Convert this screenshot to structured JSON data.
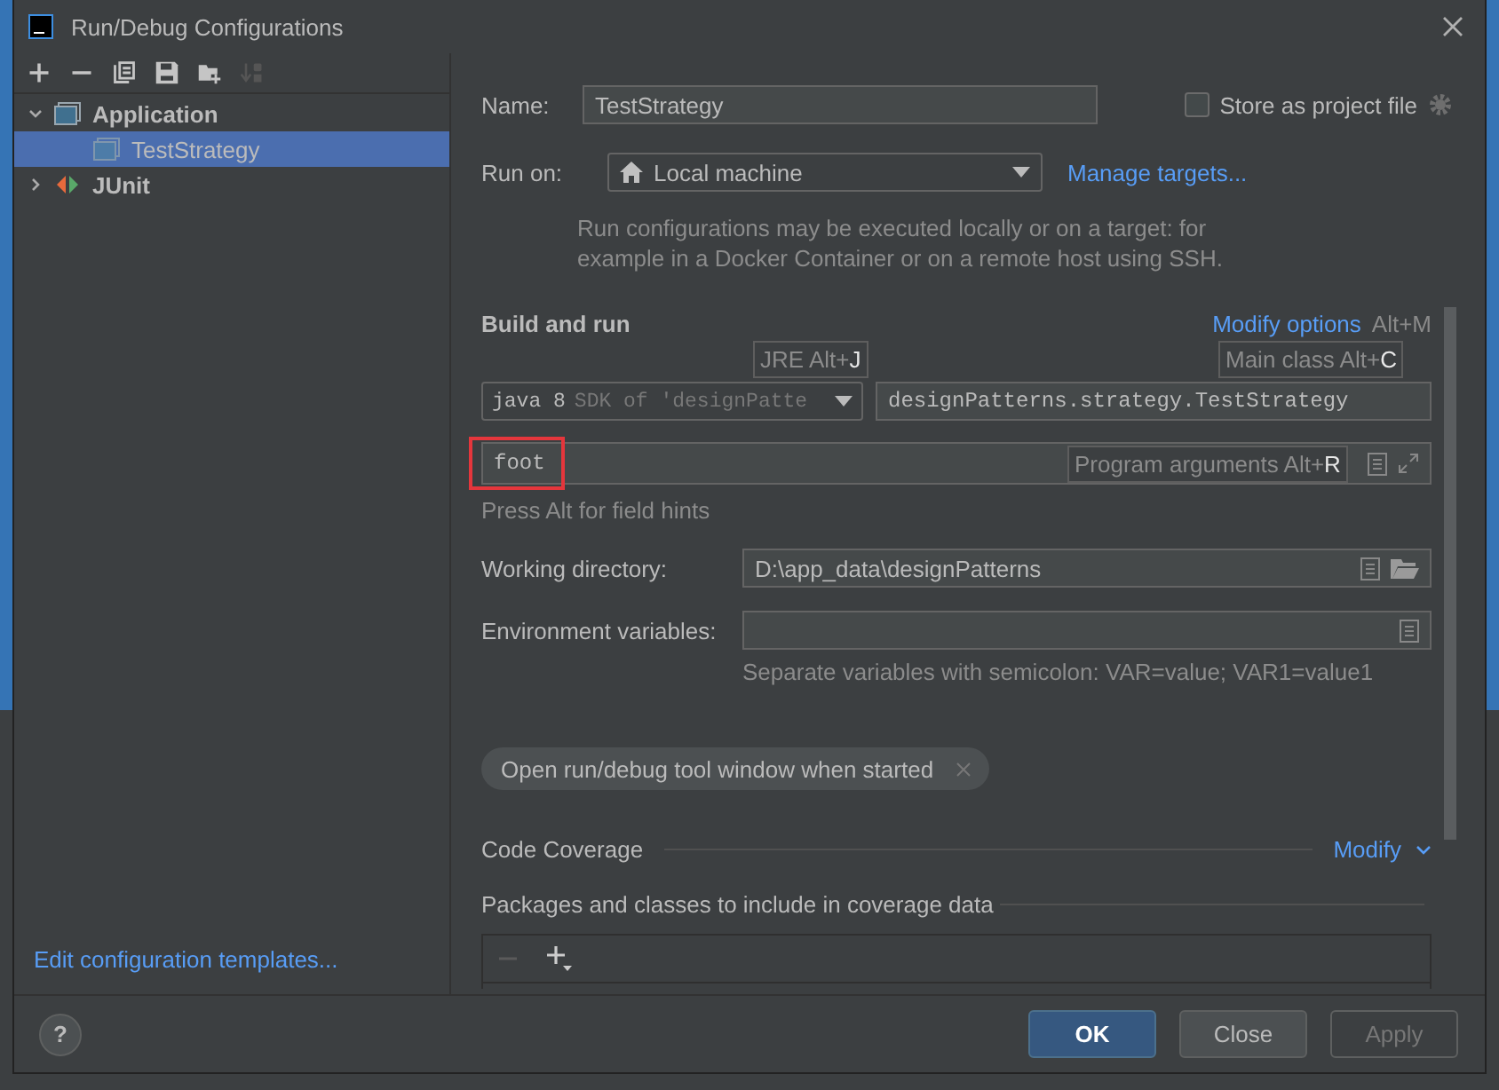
{
  "window": {
    "title": "Run/Debug Configurations"
  },
  "toolbar": [
    {
      "kind": "add",
      "disabled": false
    },
    {
      "kind": "remove",
      "disabled": false
    },
    {
      "kind": "copy",
      "disabled": false
    },
    {
      "kind": "save",
      "disabled": false
    },
    {
      "kind": "folder",
      "disabled": false
    },
    {
      "kind": "sort",
      "disabled": true
    }
  ],
  "tree": [
    {
      "label": "Application",
      "kind": "application",
      "expanded": true,
      "selected": false,
      "children": [
        {
          "label": "TestStrategy",
          "kind": "application",
          "selected": true
        }
      ]
    },
    {
      "label": "JUnit",
      "kind": "junit",
      "expanded": false,
      "selected": false
    }
  ],
  "templates_link": "Edit configuration templates...",
  "form": {
    "name_label": "Name:",
    "name_value": "TestStrategy",
    "store": {
      "label": "Store as project file",
      "checked": false
    },
    "run_on_label": "Run on:",
    "run_on_value": "Local machine",
    "manage_link": "Manage targets...",
    "run_on_hint": "Run configurations may be executed locally or on a target: for example in a Docker Container or on a remote host using SSH.",
    "build_title": "Build and run",
    "modify_options": "Modify options",
    "modify_shortcut": "Alt+M",
    "jre_value": "java 8",
    "jre_hint": "SDK of 'designPatte",
    "main_class": "designPatterns.strategy.TestStrategy",
    "program_args": "foot",
    "tooltips": [
      {
        "kind": "jre",
        "text": "JRE Alt+**J**"
      },
      {
        "kind": "main",
        "text": "Main class Alt+**C**"
      },
      {
        "kind": "args",
        "text": "Program arguments Alt+**R**"
      }
    ],
    "field_hint": "Press Alt for field hints",
    "working_dir_label": "Working directory:",
    "working_dir_value": "D:\\app_data\\designPatterns",
    "env_label": "Environment variables:",
    "env_hint": "Separate variables with semicolon: VAR=value; VAR1=value1",
    "chip": "Open run/debug tool window when started",
    "coverage_title": "Code Coverage",
    "coverage_modify": "Modify",
    "packages_title": "Packages and classes to include in coverage data"
  },
  "help": "?",
  "buttons": [
    {
      "label": "OK",
      "kind": "primary",
      "disabled": false
    },
    {
      "label": "Close",
      "kind": "normal",
      "disabled": false
    },
    {
      "label": "Apply",
      "kind": "normal",
      "disabled": true
    }
  ]
}
